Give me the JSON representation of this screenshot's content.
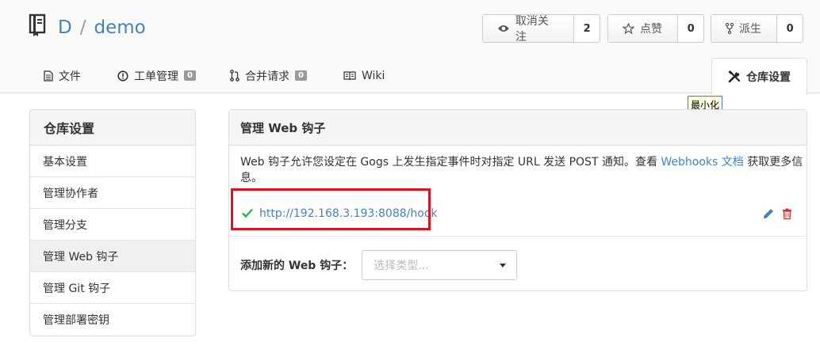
{
  "repo": {
    "owner": "D",
    "separator": "/",
    "name": "demo"
  },
  "actions": [
    {
      "label": "取消关注",
      "count": "2",
      "icon": "eye-icon"
    },
    {
      "label": "点赞",
      "count": "0",
      "icon": "star-icon"
    },
    {
      "label": "派生",
      "count": "0",
      "icon": "fork-icon"
    }
  ],
  "tabs": [
    {
      "label": "文件",
      "icon": "file-icon"
    },
    {
      "label": "工单管理",
      "badge": "0",
      "icon": "issue-icon"
    },
    {
      "label": "合并请求",
      "badge": "0",
      "icon": "pull-request-icon"
    },
    {
      "label": "Wiki",
      "icon": "book-icon"
    },
    {
      "label": "仓库设置",
      "icon": "tools-icon",
      "active": true
    }
  ],
  "tooltip": "最小化",
  "sidebar": {
    "title": "仓库设置",
    "items": [
      "基本设置",
      "管理协作者",
      "管理分支",
      "管理 Web 钩子",
      "管理 Git 钩子",
      "管理部署密钥"
    ]
  },
  "webhooks": {
    "title": "管理 Web 钩子",
    "desc_before": "Web 钩子允许您设定在 Gogs 上发生指定事件时对指定 URL 发送 POST 通知。查看 ",
    "desc_link": "Webhooks 文档",
    "desc_after": " 获取更多信息。",
    "hook_url": "http://192.168.3.193:8088/hook",
    "add_label": "添加新的 Web 钩子：",
    "select_placeholder": "选择类型..."
  },
  "colors": {
    "link": "#4183c4",
    "success": "#21ba45",
    "danger": "#db2828",
    "highlight": "#e0101e"
  }
}
